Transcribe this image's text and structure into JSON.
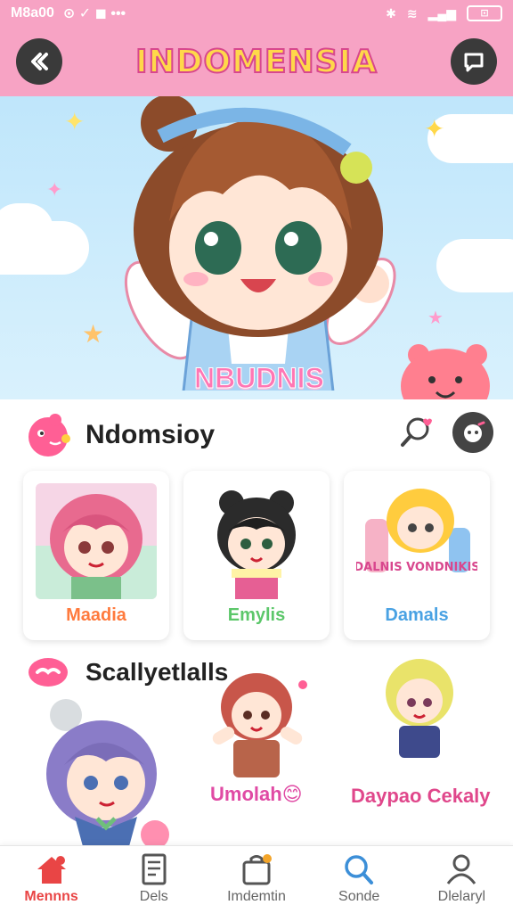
{
  "status_bar": {
    "time": "M8a00",
    "battery": "⊡"
  },
  "header": {
    "title": "INDOMENSIA"
  },
  "hero": {
    "caption": "NBUDNIS"
  },
  "section1": {
    "title": "Ndomsioy"
  },
  "cards": [
    {
      "label": "Maadia",
      "label_color": "#ff7a3d"
    },
    {
      "label": "Emylis",
      "label_color": "#5cc76a"
    },
    {
      "label": "Damals",
      "label_color": "#4aa2e3",
      "art_text": "DALNIS VONDNIKIS"
    }
  ],
  "section2": {
    "title": "Scallyetlalls"
  },
  "stickers": [
    {
      "label": "Umolah😊",
      "label_color": "#e04aa4"
    },
    {
      "label": "Daypao Cekaly",
      "label_color": "#e0478b"
    }
  ],
  "bottom_nav": [
    {
      "label": "Mennns",
      "icon": "home-icon",
      "active": true
    },
    {
      "label": "Dels",
      "icon": "notes-icon",
      "active": false
    },
    {
      "label": "Imdemtin",
      "icon": "bag-icon",
      "active": false
    },
    {
      "label": "Sonde",
      "icon": "search-icon",
      "active": false
    },
    {
      "label": "Dlelaryl",
      "icon": "profile-icon",
      "active": false
    }
  ],
  "colors": {
    "header_pink": "#f7a3c4",
    "accent_red": "#e94545",
    "title_yellow": "#ffd84a"
  }
}
